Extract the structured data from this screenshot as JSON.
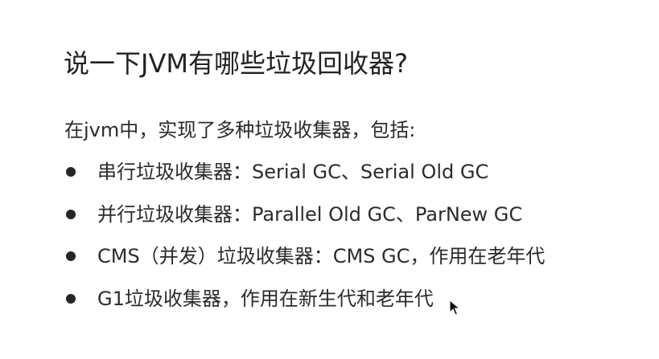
{
  "title": "说一下JVM有哪些垃圾回收器?",
  "intro": "在jvm中，实现了多种垃圾收集器，包括:",
  "bullets": [
    {
      "text": "串行垃圾收集器：Serial GC、Serial Old GC"
    },
    {
      "text": "并行垃圾收集器：Parallel Old GC、ParNew GC"
    },
    {
      "text": "CMS（并发）垃圾收集器：CMS GC，作用在老年代"
    },
    {
      "text": "G1垃圾收集器，作用在新生代和老年代"
    }
  ],
  "cursor_icon": "mouse-pointer-icon"
}
